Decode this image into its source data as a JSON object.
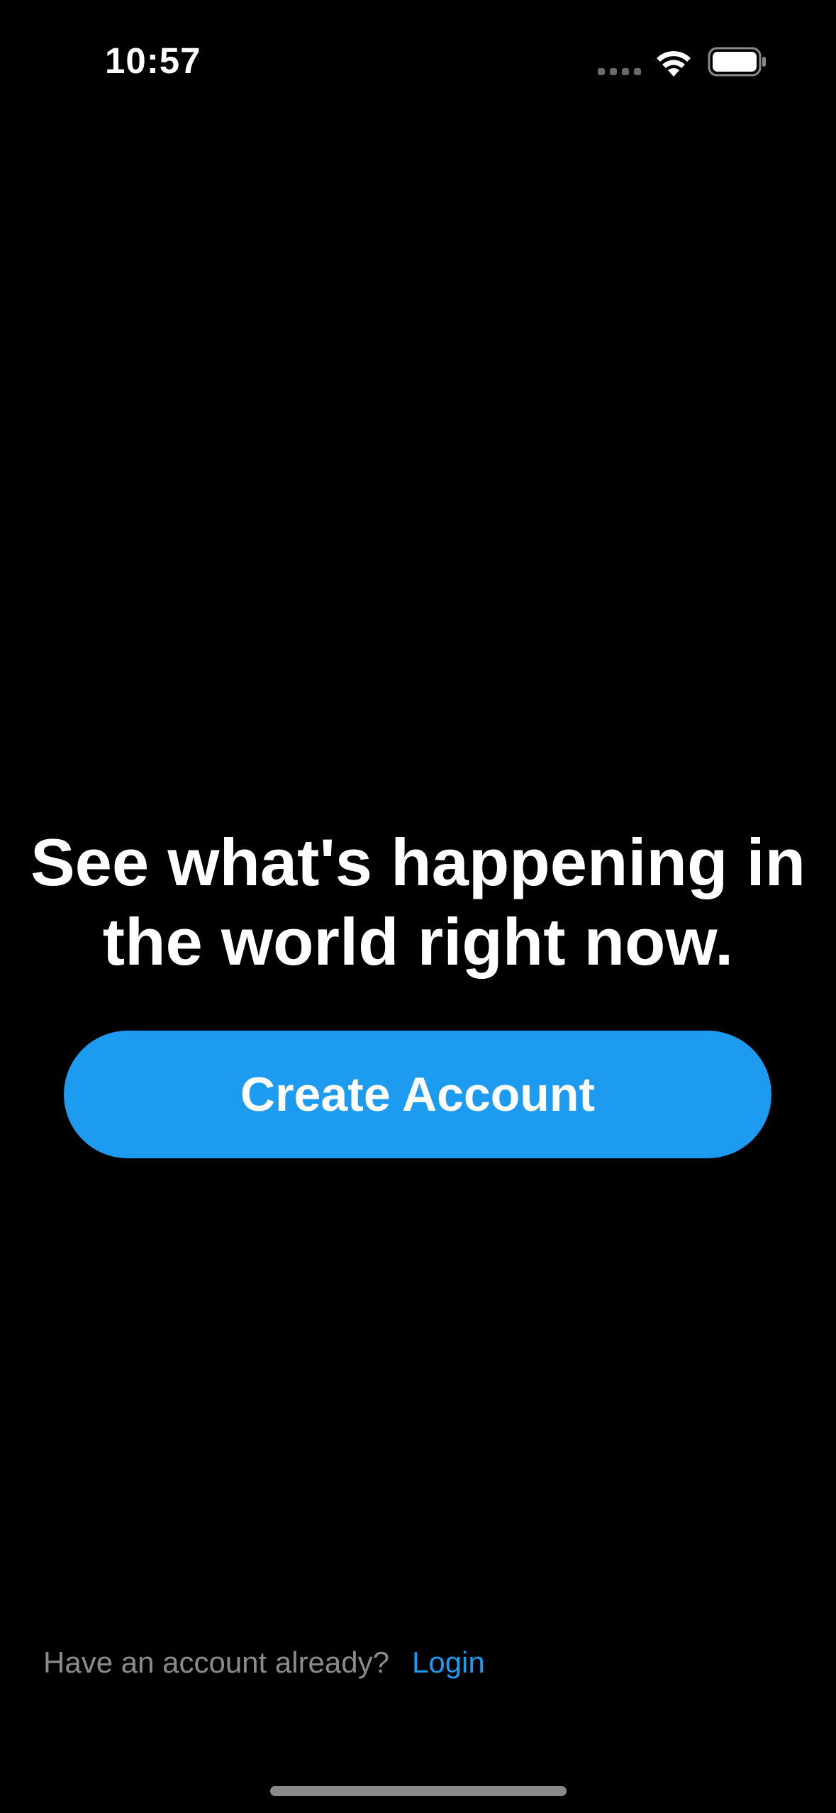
{
  "status_bar": {
    "time": "10:57",
    "icons": [
      "cellular-signal-icon",
      "wifi-icon",
      "battery-icon"
    ]
  },
  "welcome": {
    "headline": "See what's happening in the world right now.",
    "create_account_label": "Create Account"
  },
  "footer": {
    "prompt": "Have an account already?",
    "login_label": "Login"
  },
  "colors": {
    "background": "#000000",
    "accent": "#1d9bf0",
    "text": "#ffffff",
    "muted_text": "#8b8b8b"
  }
}
